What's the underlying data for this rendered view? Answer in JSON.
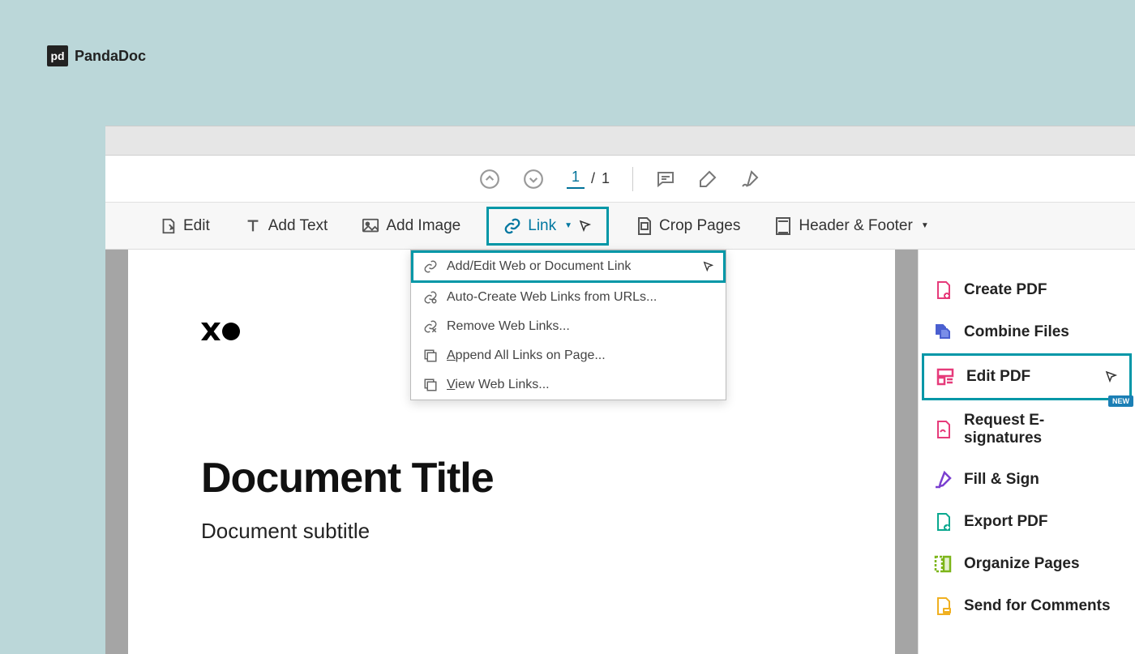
{
  "brand": {
    "name": "PandaDoc",
    "logo_glyph": "pd"
  },
  "topnav": {
    "page_current": "1",
    "page_total": "1",
    "page_separator": "/"
  },
  "toolbar": {
    "edit": "Edit",
    "add_text": "Add Text",
    "add_image": "Add Image",
    "link": "Link",
    "crop_pages": "Crop Pages",
    "header_footer": "Header & Footer"
  },
  "link_menu": {
    "items": [
      {
        "label": "Add/Edit Web or Document Link",
        "highlighted": true
      },
      {
        "label": "Auto-Create Web Links from URLs..."
      },
      {
        "label": "Remove Web Links..."
      },
      {
        "label": "Append All Links on Page..."
      },
      {
        "label": "View Web Links..."
      }
    ]
  },
  "document": {
    "title": "Document Title",
    "subtitle": "Document subtitle"
  },
  "sidebar": {
    "items": [
      {
        "label": "Create PDF",
        "color": "#e63b7a",
        "icon": "create"
      },
      {
        "label": "Combine Files",
        "color": "#4a5fd0",
        "icon": "combine"
      },
      {
        "label": "Edit PDF",
        "color": "#e63b7a",
        "icon": "edit",
        "highlighted": true
      },
      {
        "label": "Request E-signatures",
        "color": "#e63b7a",
        "icon": "esign",
        "badge": "NEW"
      },
      {
        "label": "Fill & Sign",
        "color": "#7b3fd0",
        "icon": "fill"
      },
      {
        "label": "Export PDF",
        "color": "#0aa88f",
        "icon": "export"
      },
      {
        "label": "Organize Pages",
        "color": "#7cb518",
        "icon": "organize"
      },
      {
        "label": "Send for Comments",
        "color": "#f0b020",
        "icon": "send"
      }
    ]
  }
}
